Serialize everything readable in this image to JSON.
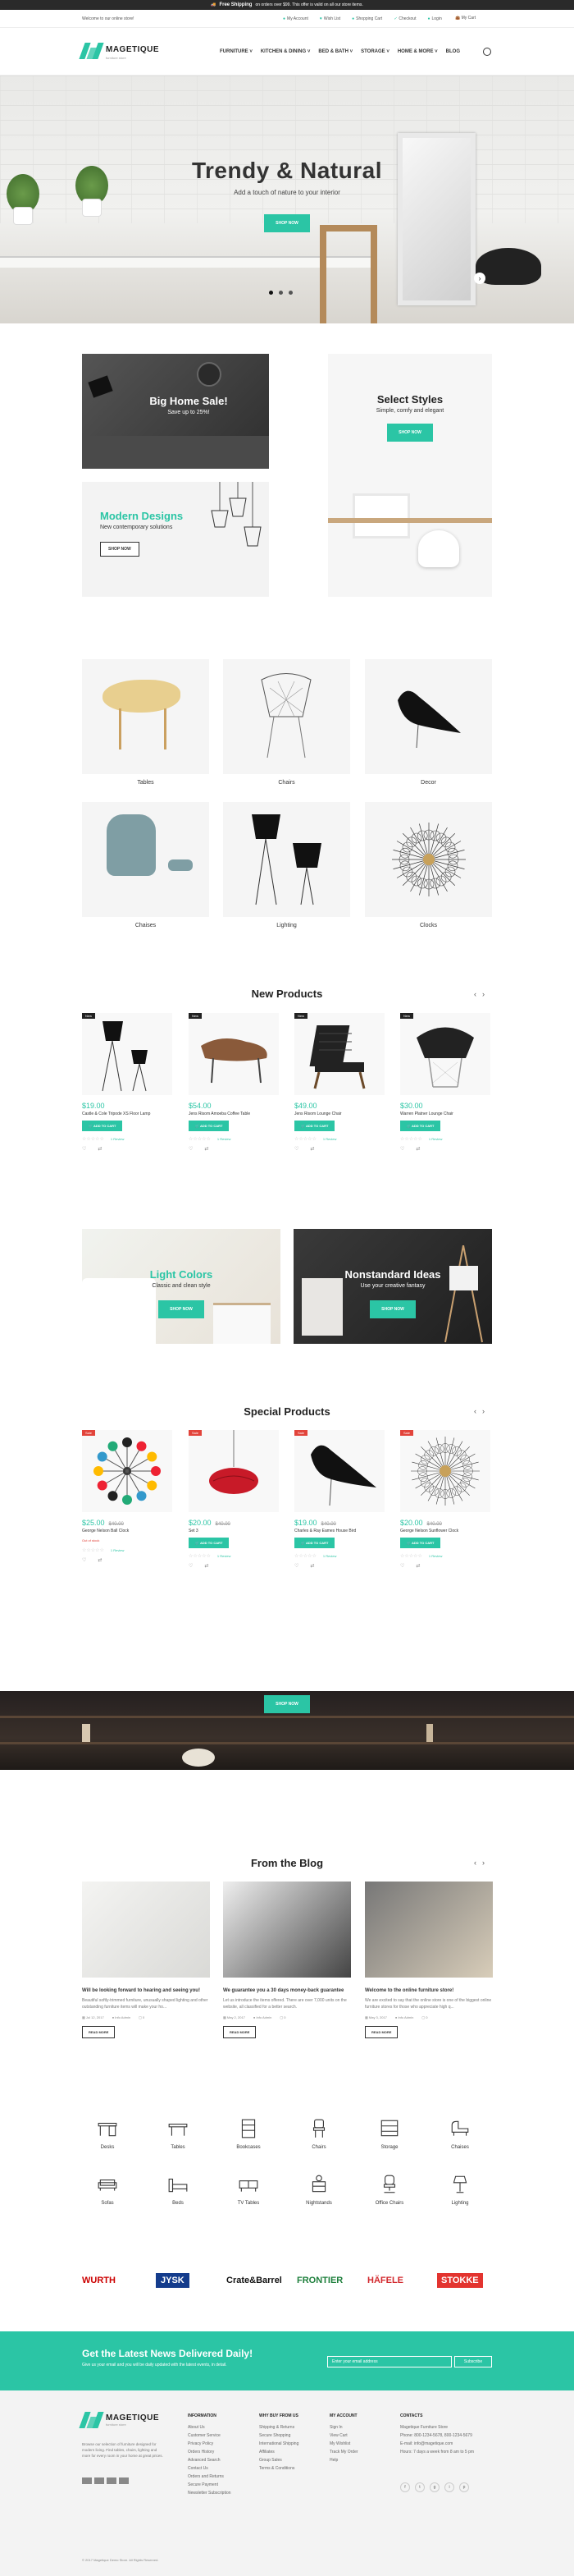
{
  "topbar": {
    "free": "Free Shipping",
    "text": "on orders over $99. This offer is valid on all our store items."
  },
  "utility": {
    "welcome": "Welcome to our online store!",
    "links": [
      {
        "icon": "user-icon",
        "label": "My Account"
      },
      {
        "icon": "heart-icon",
        "label": "Wish List"
      },
      {
        "icon": "cart-icon",
        "label": "Shopping Cart"
      },
      {
        "icon": "check-icon",
        "label": "Checkout"
      },
      {
        "icon": "lock-icon",
        "label": "Login"
      }
    ],
    "cart": "My Cart"
  },
  "header": {
    "logo": "MAGETIQUE",
    "tagline": "furniture store",
    "nav": [
      "FURNITURE ˅",
      "KITCHEN & DINING ˅",
      "BED & BATH ˅",
      "STORAGE ˅",
      "HOME & MORE ˅",
      "BLOG"
    ]
  },
  "hero": {
    "title": "Trendy & Natural",
    "subtitle": "Add a touch of nature to your interior",
    "button": "SHOP NOW"
  },
  "banners": {
    "b1": {
      "title": "Big Home Sale!",
      "subtitle": "Save up to 25%!"
    },
    "b2": {
      "title": "Modern Designs",
      "subtitle": "New contemporary solutions",
      "button": "SHOP NOW"
    },
    "b3": {
      "title": "Select Styles",
      "subtitle": "Simple, comfy and elegant",
      "button": "SHOP NOW"
    }
  },
  "categories": [
    "Tables",
    "Chairs",
    "Decor",
    "Chaises",
    "Lighting",
    "Clocks"
  ],
  "new_products": {
    "title": "New Products",
    "items": [
      {
        "badge": "New",
        "price": "$19.00",
        "name": "Castle & Cole Tripode XS Floor Lamp",
        "add": "ADD TO CART",
        "reviews": "1 Review"
      },
      {
        "badge": "New",
        "price": "$54.00",
        "name": "Jens Risom Amoeba Coffee Table",
        "add": "ADD TO CART",
        "reviews": "1 Review"
      },
      {
        "badge": "New",
        "price": "$49.00",
        "name": "Jens Risom Lounge Chair",
        "add": "ADD TO CART",
        "reviews": "1 Review"
      },
      {
        "badge": "New",
        "price": "$30.00",
        "name": "Warren Platner Lounge Chair",
        "add": "ADD TO CART",
        "reviews": "1 Review"
      }
    ]
  },
  "wide": {
    "w1": {
      "title": "Light Colors",
      "subtitle": "Classic and clean style",
      "button": "SHOP NOW"
    },
    "w2": {
      "title": "Nonstandard Ideas",
      "subtitle": "Use your creative fantasy",
      "button": "SHOP NOW"
    }
  },
  "special_products": {
    "title": "Special Products",
    "items": [
      {
        "badge": "Sale",
        "price": "$25.00",
        "old": "$40.00",
        "name": "George Nelson Ball Clock",
        "add": "Out of stock",
        "reviews": "1 Review"
      },
      {
        "badge": "Sale",
        "price": "$20.00",
        "old": "$40.00",
        "name": "Set 3",
        "add": "ADD TO CART",
        "reviews": "1 Review"
      },
      {
        "badge": "Sale",
        "price": "$19.00",
        "old": "$40.00",
        "name": "Charles & Ray Eames House Bird",
        "add": "ADD TO CART",
        "reviews": "1 Review"
      },
      {
        "badge": "Sale",
        "price": "$20.00",
        "old": "$40.00",
        "name": "George Nelson Sunflower Clock",
        "add": "ADD TO CART",
        "reviews": "1 Review"
      }
    ]
  },
  "bookshelf": {
    "button": "SHOP NOW"
  },
  "blog": {
    "title": "From the Blog",
    "posts": [
      {
        "title": "Will be looking forward to hearing and seeing you!",
        "excerpt": "Beautiful softly-trimmed furniture, unusually shaped lighting and other outstanding furniture items will make your ho...",
        "date": "Jul 12, 2017",
        "author": "Info Admin",
        "comments": "0",
        "more": "READ MORE"
      },
      {
        "title": "We guarantee you a 30 days money-back guarantee",
        "excerpt": "Let us introduce the items offered. There are over 7,000 units on the website, all classified for a better search.",
        "date": "May 2, 2017",
        "author": "Info Admin",
        "comments": "0",
        "more": "READ MORE"
      },
      {
        "title": "Welcome to the online furniture store!",
        "excerpt": "We are excited to say that the online store is one of the biggest online furniture stores for those who appreciate high q...",
        "date": "May 3, 2017",
        "author": "Info Admin",
        "comments": "0",
        "more": "READ MORE"
      }
    ]
  },
  "icon_categories": [
    "Desks",
    "Tables",
    "Bookcases",
    "Chairs",
    "Storage",
    "Chaises",
    "Sofas",
    "Beds",
    "TV Tables",
    "Nightstands",
    "Office Chairs",
    "Lighting"
  ],
  "brands": [
    {
      "name": "WURTH",
      "color": "#cc0000"
    },
    {
      "name": "JYSK",
      "color": "#143c8c"
    },
    {
      "name": "Crate&Barrel",
      "color": "#111111"
    },
    {
      "name": "FRONTIER",
      "color": "#1e7f3c"
    },
    {
      "name": "HÄFELE",
      "color": "#d2282d"
    },
    {
      "name": "STOKKE",
      "color": "#e3342f"
    }
  ],
  "newsletter": {
    "title": "Get the Latest News Delivered Daily!",
    "subtitle": "Give us your email and you will be daily updated with the latest events, in detail.",
    "placeholder": "Enter your email address",
    "button": "Subscribe"
  },
  "footer": {
    "logo": "MAGETIQUE",
    "tagline": "furniture store",
    "about": "Browse our selection of furniture designed for modern living. Find tables, chairs, lighting and more for every room in your home at great prices.",
    "cols": [
      {
        "title": "INFORMATION",
        "items": [
          "About Us",
          "Customer Service",
          "Privacy Policy",
          "Orders History",
          "Advanced Search",
          "Contact Us",
          "Orders and Returns",
          "Secure Payment",
          "Newsletter Subscription"
        ]
      },
      {
        "title": "WHY BUY FROM US",
        "items": [
          "Shipping & Returns",
          "Secure Shopping",
          "International Shipping",
          "Affiliates",
          "Group Sales",
          "Terms & Conditions"
        ]
      },
      {
        "title": "MY ACCOUNT",
        "items": [
          "Sign In",
          "View Cart",
          "My Wishlist",
          "Track My Order",
          "Help"
        ]
      },
      {
        "title": "CONTACTS",
        "items": [
          "Magetique Furniture Store",
          "Phone: 800-1234-5678, 800-1234-5679",
          "E-mail: info@magetique.com",
          "Hours: 7 days a week from 8 am to 5 pm"
        ]
      }
    ],
    "copyright": "© 2017 Magetique Demo Store. All Rights Reserved."
  },
  "colors": {
    "accent": "#2bc5a5",
    "dark": "#222222",
    "sale": "#e2443b"
  }
}
